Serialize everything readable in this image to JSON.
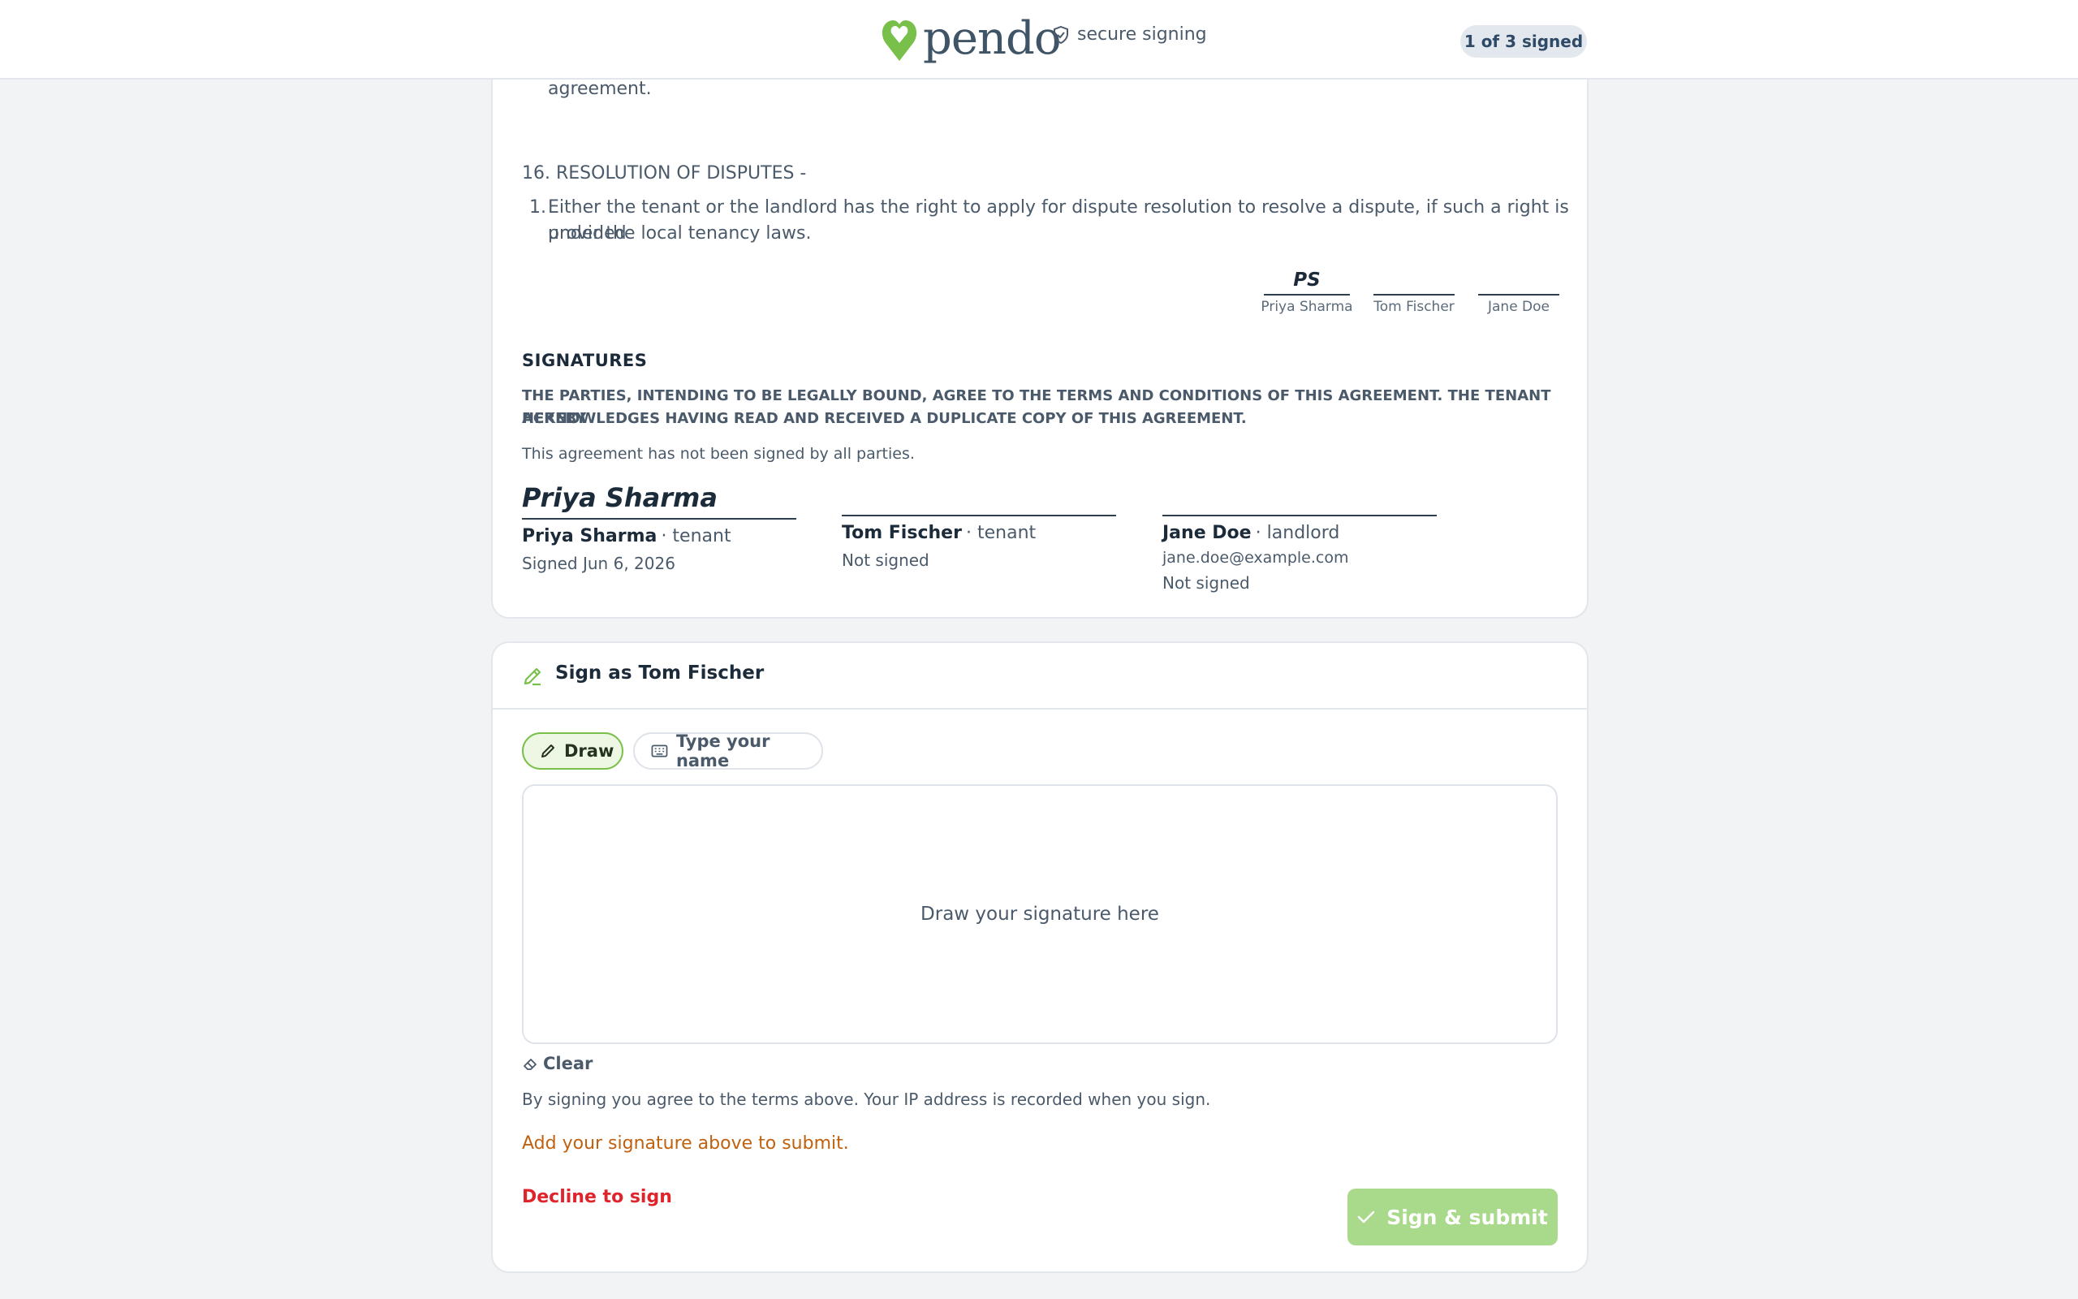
{
  "header": {
    "brand_name": "pendo",
    "secure_label": "secure signing",
    "signed_status": "1 of 3 signed"
  },
  "document": {
    "prev_clause_tail": "agreement.",
    "clause16": {
      "heading": "16. RESOLUTION OF DISPUTES -",
      "item_number": "1.",
      "item_text_line1": "Either the tenant or the landlord has the right to apply for dispute resolution to resolve a dispute, if such a right is provided",
      "item_text_line2": "under the local tenancy laws."
    },
    "initials": [
      {
        "name": "Priya Sharma",
        "initials": "PS"
      },
      {
        "name": "Tom Fischer",
        "initials": ""
      },
      {
        "name": "Jane Doe",
        "initials": ""
      }
    ],
    "signatures": {
      "heading": "SIGNATURES",
      "statement_line1": "THE PARTIES, INTENDING TO BE LEGALLY BOUND, AGREE TO THE TERMS AND CONDITIONS OF THIS AGREEMENT. THE TENANT HEREBY",
      "statement_line2": "ACKNOWLEDGES HAVING READ AND RECEIVED A DUPLICATE COPY OF THIS AGREEMENT.",
      "status_note": "This agreement has not been signed by all parties.",
      "parties": [
        {
          "signature": "Priya Sharma",
          "name": "Priya Sharma",
          "role": "· tenant",
          "status": "Signed Jun 6, 2026"
        },
        {
          "signature": "",
          "name": "Tom Fischer",
          "role": "· tenant",
          "status": "Not signed"
        },
        {
          "signature": "",
          "name": "Jane Doe",
          "role": "· landlord",
          "email": "jane.doe@example.com",
          "status": "Not signed"
        }
      ]
    }
  },
  "sign_panel": {
    "title": "Sign as Tom Fischer",
    "tab_draw": "Draw",
    "tab_type": "Type your name",
    "pad_placeholder": "Draw your signature here",
    "clear_label": "Clear",
    "consent_text": "By signing you agree to the terms above. Your IP address is recorded when you sign.",
    "warning_text": "Add your signature above to submit.",
    "decline_label": "Decline to sign",
    "submit_label": "Sign & submit"
  },
  "colors": {
    "accent_green": "#79c04a",
    "submit_disabled": "#a9d98a",
    "warning": "#c0610f",
    "danger": "#e0242b"
  },
  "icons": [
    "pendo-heart-logo",
    "shield-check-icon",
    "pencil-icon",
    "keyboard-icon",
    "eraser-icon",
    "check-icon"
  ]
}
